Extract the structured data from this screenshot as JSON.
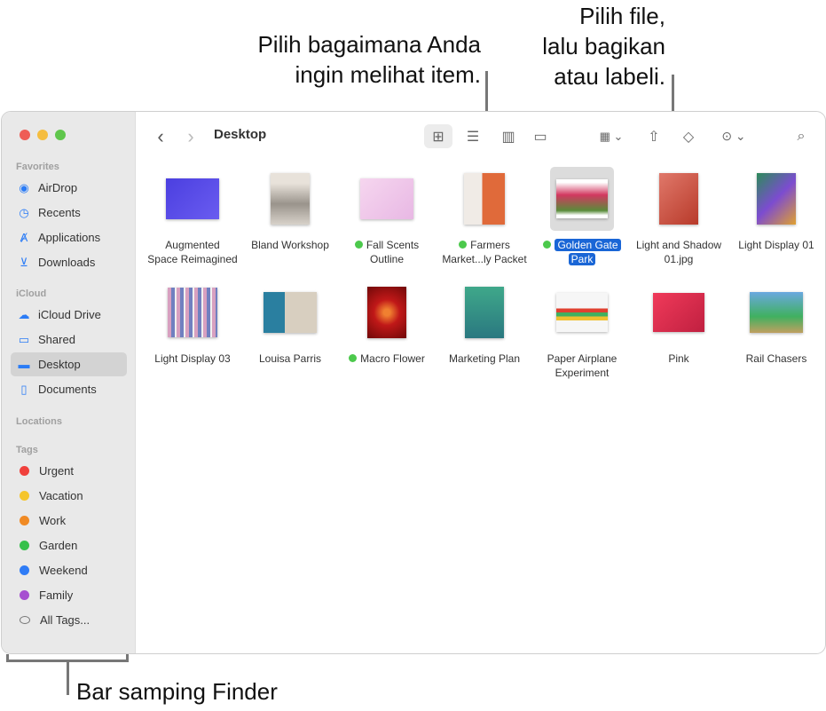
{
  "callouts": {
    "view": "Pilih bagaimana Anda ingin melihat item.",
    "view_lines": [
      "Pilih bagaimana Anda",
      "ingin melihat item."
    ],
    "share_lines": [
      "Pilih file,",
      "lalu bagikan",
      "atau labeli."
    ],
    "sidebar": "Bar samping Finder"
  },
  "sidebar": {
    "favorites_label": "Favorites",
    "favorites": [
      {
        "label": "AirDrop",
        "icon": "airdrop-icon"
      },
      {
        "label": "Recents",
        "icon": "clock-icon"
      },
      {
        "label": "Applications",
        "icon": "applications-icon"
      },
      {
        "label": "Downloads",
        "icon": "download-icon"
      }
    ],
    "icloud_label": "iCloud",
    "icloud": [
      {
        "label": "iCloud Drive",
        "icon": "cloud-icon"
      },
      {
        "label": "Shared",
        "icon": "shared-folder-icon"
      },
      {
        "label": "Desktop",
        "icon": "desktop-icon",
        "active": true
      },
      {
        "label": "Documents",
        "icon": "document-icon"
      }
    ],
    "locations_label": "Locations",
    "tags_label": "Tags",
    "tags": [
      {
        "label": "Urgent",
        "color": "#f0403c"
      },
      {
        "label": "Vacation",
        "color": "#f5c52c"
      },
      {
        "label": "Work",
        "color": "#f08a24"
      },
      {
        "label": "Garden",
        "color": "#35c04a"
      },
      {
        "label": "Weekend",
        "color": "#2f7cf6"
      },
      {
        "label": "Family",
        "color": "#a64fd0"
      },
      {
        "label": "All Tags...",
        "color": ""
      }
    ]
  },
  "toolbar": {
    "title": "Desktop"
  },
  "files": [
    {
      "name": "Augmented Space Reimagined",
      "lines": [
        "Augmented",
        "Space Reimagined"
      ],
      "tag": false
    },
    {
      "name": "Bland Workshop",
      "lines": [
        "Bland Workshop"
      ],
      "tag": false
    },
    {
      "name": "Fall Scents Outline",
      "lines": [
        "Fall Scents",
        "Outline"
      ],
      "tag": true
    },
    {
      "name": "Farmers Market...ly Packet",
      "lines": [
        "Farmers",
        "Market...ly Packet"
      ],
      "tag": true
    },
    {
      "name": "Golden Gate Park",
      "lines": [
        "Golden Gate",
        "Park"
      ],
      "tag": true,
      "selected": true
    },
    {
      "name": "Light and Shadow 01.jpg",
      "lines": [
        "Light and Shadow",
        "01.jpg"
      ],
      "tag": false
    },
    {
      "name": "Light Display 01",
      "lines": [
        "Light Display 01"
      ],
      "tag": false
    },
    {
      "name": "Light Display 03",
      "lines": [
        "Light Display 03"
      ],
      "tag": false
    },
    {
      "name": "Louisa Parris",
      "lines": [
        "Louisa Parris"
      ],
      "tag": false
    },
    {
      "name": "Macro Flower",
      "lines": [
        "Macro Flower"
      ],
      "tag": true
    },
    {
      "name": "Marketing Plan",
      "lines": [
        "Marketing Plan"
      ],
      "tag": false
    },
    {
      "name": "Paper Airplane Experiment",
      "lines": [
        "Paper Airplane",
        "Experiment"
      ],
      "tag": false
    },
    {
      "name": "Pink",
      "lines": [
        "Pink"
      ],
      "tag": false
    },
    {
      "name": "Rail Chasers",
      "lines": [
        "Rail Chasers"
      ],
      "tag": false
    }
  ]
}
